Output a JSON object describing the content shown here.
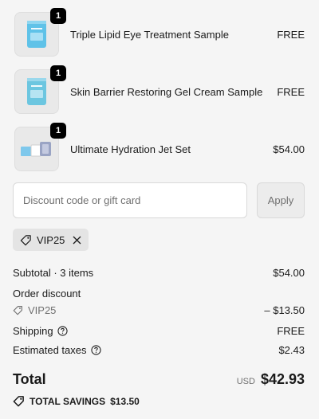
{
  "line_items": [
    {
      "name": "Triple Lipid Eye Treatment Sample",
      "quantity": "1",
      "price": "FREE",
      "thumbnail_icon": "sample-packet-icon"
    },
    {
      "name": "Skin Barrier Restoring Gel Cream Sample",
      "quantity": "1",
      "price": "FREE",
      "thumbnail_icon": "sample-packet-icon"
    },
    {
      "name": "Ultimate Hydration Jet Set",
      "quantity": "1",
      "price": "$54.00",
      "thumbnail_icon": "product-set-icon"
    }
  ],
  "discount": {
    "placeholder": "Discount code or gift card",
    "value": "",
    "apply_label": "Apply",
    "applied_code": "VIP25"
  },
  "summary": {
    "subtotal_label": "Subtotal · 3 items",
    "subtotal_value": "$54.00",
    "order_discount_label": "Order discount",
    "order_discount_code": "VIP25",
    "order_discount_value": "– $13.50",
    "shipping_label": "Shipping",
    "shipping_value": "FREE",
    "taxes_label": "Estimated taxes",
    "taxes_value": "$2.43"
  },
  "total": {
    "label": "Total",
    "currency": "USD",
    "amount": "$42.93"
  },
  "savings": {
    "label": "TOTAL SAVINGS",
    "amount": "$13.50"
  },
  "colors": {
    "background": "#f5f5f5",
    "packet_blue": "#5fc2e8",
    "badge": "#000000",
    "muted_text": "#707070"
  }
}
